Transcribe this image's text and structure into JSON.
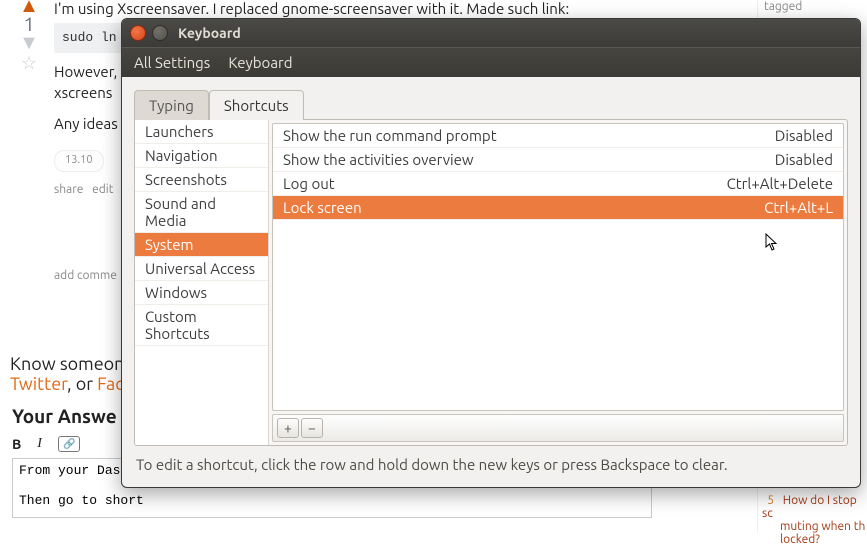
{
  "qa": {
    "score": "1",
    "body_line1": "I'm using Xscreensaver. I replaced gnome-screensaver with it. Made such link:",
    "code1": "sudo ln ",
    "body_line2a": "However,",
    "body_line2b": "xscreens",
    "body_line3": "Any ideas",
    "tag": "13.10",
    "actions_share": "share",
    "actions_edit": "edit",
    "add_comment": "add comme",
    "know": "Know someon",
    "twitter": "Twitter",
    "or": ", or ",
    "fac": "Fac",
    "your_answer": "Your Answe",
    "answer_text": "From your Dash \n\nThen go to short"
  },
  "right": {
    "tagged": "tagged",
    "hot_num": "5",
    "hot_a": "How do I stop sc",
    "hot_b": "muting when th",
    "hot_c": "locked?"
  },
  "window": {
    "title": "Keyboard",
    "crumb_all": "All Settings",
    "crumb_here": "Keyboard",
    "tab_typing": "Typing",
    "tab_shortcuts": "Shortcuts",
    "categories": [
      "Launchers",
      "Navigation",
      "Screenshots",
      "Sound and Media",
      "System",
      "Universal Access",
      "Windows",
      "Custom Shortcuts"
    ],
    "selected_category_index": 4,
    "shortcuts": [
      {
        "label": "Show the run command prompt",
        "key": "Disabled"
      },
      {
        "label": "Show the activities overview",
        "key": "Disabled"
      },
      {
        "label": "Log out",
        "key": "Ctrl+Alt+Delete"
      },
      {
        "label": "Lock screen",
        "key": "Ctrl+Alt+L"
      }
    ],
    "selected_shortcut_index": 3,
    "hint": "To edit a shortcut, click the row and hold down the new keys or press Backspace to clear."
  },
  "icons": {
    "plus": "+",
    "minus": "−",
    "bold": "B",
    "italic": "I",
    "link": "🔗"
  }
}
